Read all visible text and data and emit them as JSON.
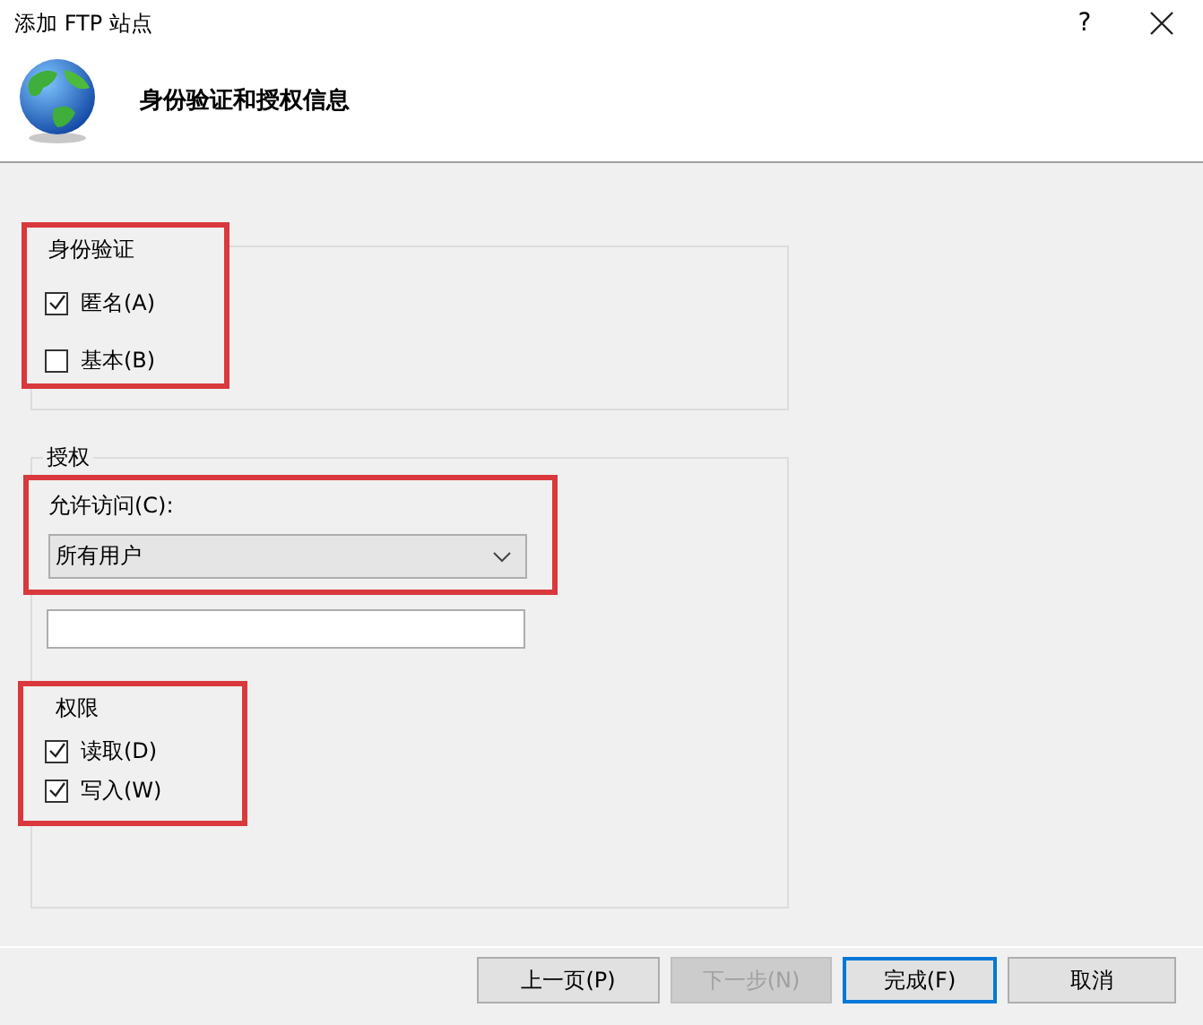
{
  "window": {
    "title": "添加 FTP 站点",
    "help": "?"
  },
  "header": {
    "title": "身份验证和授权信息"
  },
  "authentication": {
    "title": "身份验证",
    "highlighted": true,
    "options": [
      {
        "label": "匿名(A)",
        "checked": true
      },
      {
        "label": "基本(B)",
        "checked": false
      }
    ]
  },
  "authorization": {
    "title": "授权",
    "allow_access": {
      "label": "允许访问(C):",
      "value": "所有用户",
      "highlighted": true
    },
    "permissions": {
      "title": "权限",
      "highlighted": true,
      "options": [
        {
          "label": "读取(D)",
          "checked": true
        },
        {
          "label": "写入(W)",
          "checked": true
        }
      ]
    }
  },
  "buttons": [
    {
      "label": "上一页(P)",
      "disabled": false,
      "default": false
    },
    {
      "label": "下一步(N)",
      "disabled": true,
      "default": false
    },
    {
      "label": "完成(F)",
      "disabled": false,
      "default": true
    },
    {
      "label": "取消",
      "disabled": false,
      "default": false
    }
  ]
}
